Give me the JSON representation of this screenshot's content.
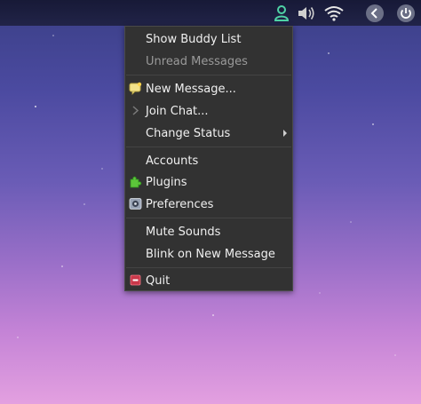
{
  "menu": {
    "items": [
      {
        "label": "Show Buddy List"
      },
      {
        "label": "Unread Messages"
      },
      {
        "label": "New Message..."
      },
      {
        "label": "Join Chat..."
      },
      {
        "label": "Change Status"
      },
      {
        "label": "Accounts"
      },
      {
        "label": "Plugins"
      },
      {
        "label": "Preferences"
      },
      {
        "label": "Mute Sounds"
      },
      {
        "label": "Blink on New Message"
      },
      {
        "label": "Quit"
      }
    ]
  },
  "tray": {
    "icons": [
      "pidgin-buddy-icon",
      "volume-icon",
      "wifi-icon",
      "back-icon",
      "power-icon"
    ]
  },
  "colors": {
    "menu_bg": "#323232",
    "menu_text": "#f0f0f0",
    "disabled_text": "#9a9a9a",
    "topbar": "#1a1c36"
  }
}
